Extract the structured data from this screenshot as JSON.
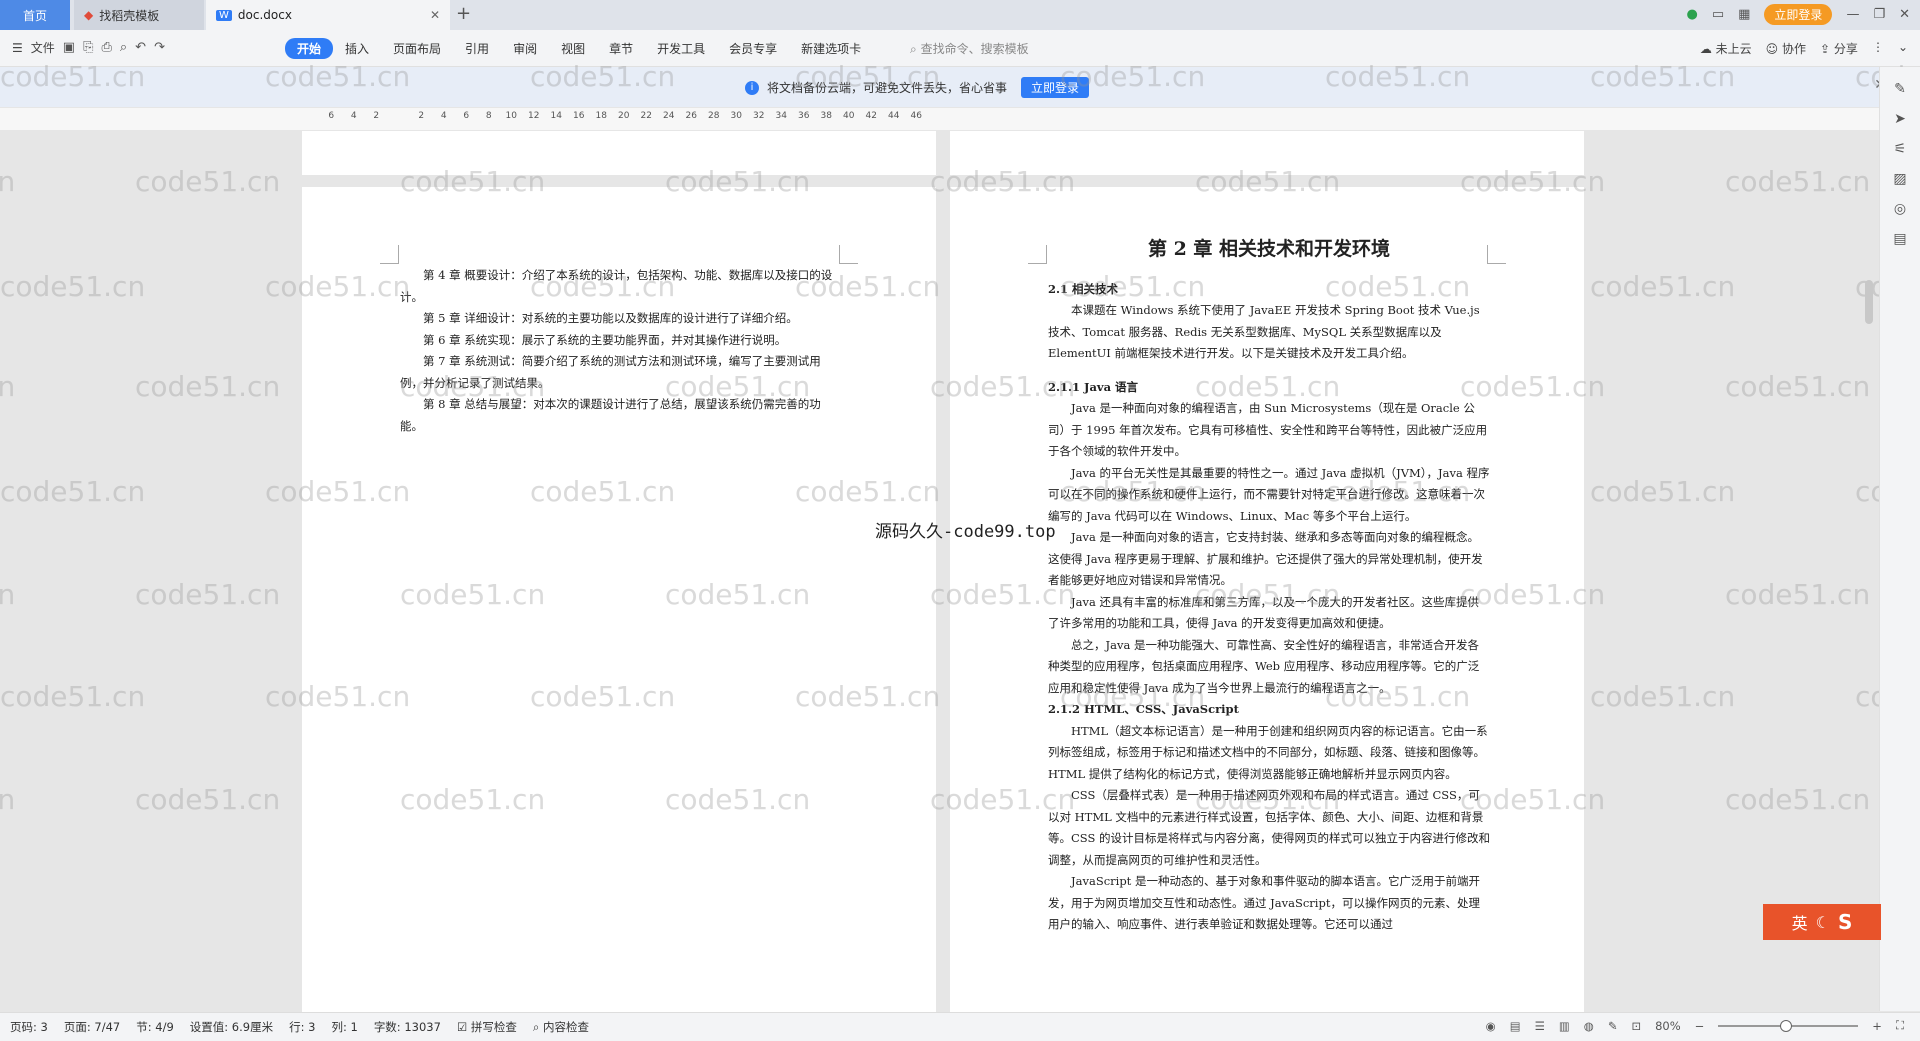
{
  "tabs": {
    "home": "首页",
    "daoke": "找稻壳模板",
    "doc": "doc.docx"
  },
  "titlebar": {
    "login": "立即登录"
  },
  "menu": {
    "file": "文件",
    "ribbon_tabs": [
      "开始",
      "插入",
      "页面布局",
      "引用",
      "审阅",
      "视图",
      "章节",
      "开发工具",
      "会员专享",
      "新建选项卡"
    ],
    "search_placeholder": "查找命令、搜索模板",
    "cloud": "未上云",
    "collab": "协作",
    "share": "分享"
  },
  "notice": {
    "text": "将文档备份云端，可避免文件丢失，省心省事",
    "button": "立即登录"
  },
  "ruler": {
    "marks": [
      "6",
      "4",
      "2",
      "",
      "2",
      "4",
      "6",
      "8",
      "10",
      "12",
      "14",
      "16",
      "18",
      "20",
      "22",
      "24",
      "26",
      "28",
      "30",
      "32",
      "34",
      "36",
      "38",
      "40",
      "42",
      "44",
      "46"
    ]
  },
  "left_page": {
    "paragraphs": [
      "第 4 章 概要设计：介绍了本系统的设计，包括架构、功能、数据库以及接口的设计。",
      "第 5 章 详细设计：对系统的主要功能以及数据库的设计进行了详细介绍。",
      "第 6 章 系统实现：展示了系统的主要功能界面，并对其操作进行说明。",
      "第 7 章 系统测试：简要介绍了系统的测试方法和测试环境，编写了主要测试用例，并分析记录了测试结果。",
      "第 8 章 总结与展望：对本次的课题设计进行了总结，展望该系统仍需完善的功能。"
    ]
  },
  "right_page": {
    "chapter": "第 2 章  相关技术和开发环境",
    "section_2_1": "2.1 相关技术",
    "intro": "本课题在 Windows 系统下使用了 JavaEE 开发技术 Spring Boot 技术 Vue.js 技术、Tomcat 服务器、Redis 无关系型数据库、MySQL 关系型数据库以及 ElementUI 前端框架技术进行开发。以下是关键技术及开发工具介绍。",
    "section_2_1_1": "2.1.1 Java 语言",
    "java_paragraphs": [
      "Java 是一种面向对象的编程语言，由 Sun Microsystems（现在是 Oracle 公司）于 1995 年首次发布。它具有可移植性、安全性和跨平台等特性，因此被广泛应用于各个领域的软件开发中。",
      "Java 的平台无关性是其最重要的特性之一。通过 Java 虚拟机（JVM），Java 程序可以在不同的操作系统和硬件上运行，而不需要针对特定平台进行修改。这意味着一次编写的 Java 代码可以在 Windows、Linux、Mac 等多个平台上运行。",
      "Java 是一种面向对象的语言，它支持封装、继承和多态等面向对象的编程概念。这使得 Java 程序更易于理解、扩展和维护。它还提供了强大的异常处理机制，使开发者能够更好地应对错误和异常情况。",
      "Java 还具有丰富的标准库和第三方库，以及一个庞大的开发者社区。这些库提供了许多常用的功能和工具，使得 Java 的开发变得更加高效和便捷。",
      "总之，Java 是一种功能强大、可靠性高、安全性好的编程语言，非常适合开发各种类型的应用程序，包括桌面应用程序、Web 应用程序、移动应用程序等。它的广泛应用和稳定性使得 Java 成为了当今世界上最流行的编程语言之一。"
    ],
    "section_2_1_2": "2.1.2 HTML、CSS、JavaScript",
    "web_paragraphs": [
      "HTML（超文本标记语言）是一种用于创建和组织网页内容的标记语言。它由一系列标签组成，标签用于标记和描述文档中的不同部分，如标题、段落、链接和图像等。HTML 提供了结构化的标记方式，使得浏览器能够正确地解析并显示网页内容。",
      "CSS（层叠样式表）是一种用于描述网页外观和布局的样式语言。通过 CSS，可以对 HTML 文档中的元素进行样式设置，包括字体、颜色、大小、间距、边框和背景等。CSS 的设计目标是将样式与内容分离，使得网页的样式可以独立于内容进行修改和调整，从而提高网页的可维护性和灵活性。",
      "JavaScript 是一种动态的、基于对象和事件驱动的脚本语言。它广泛用于前端开发，用于为网页增加交互性和动态性。通过 JavaScript，可以操作网页的元素、处理用户的输入、响应事件、进行表单验证和数据处理等。它还可以通过"
    ]
  },
  "overlay": {
    "center_mark": "源码久久-code99.top",
    "watermark": "code51.cn"
  },
  "ime": {
    "label": "英"
  },
  "status": {
    "page_code": "页码: 3",
    "page": "页面: 7/47",
    "section": "节: 4/9",
    "setting": "设置值: 6.9厘米",
    "row": "行: 3",
    "col": "列: 1",
    "words": "字数: 13037",
    "spell": "拼写检查",
    "content_check": "内容检查",
    "zoom": "80%"
  }
}
